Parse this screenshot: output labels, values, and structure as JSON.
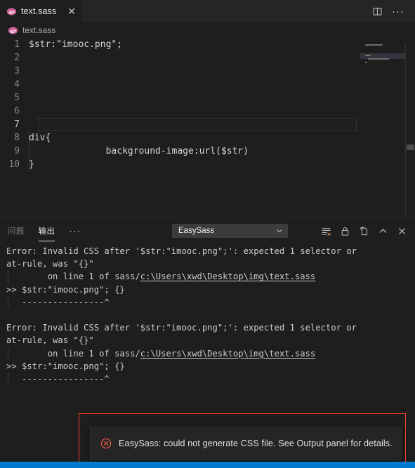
{
  "window": {
    "background": "#1e1e1e",
    "accent": "#007acc",
    "annotation_color": "#ef3b2d"
  },
  "tabbar": {
    "tabs": [
      {
        "label": "text.sass",
        "icon": "sass-icon",
        "close_label": "✕",
        "active": true
      }
    ],
    "actions": [
      {
        "name": "split-editor-icon",
        "label": ""
      },
      {
        "name": "more-actions-icon",
        "label": "···"
      }
    ]
  },
  "breadcrumb": {
    "icon": "sass-icon",
    "label": "text.sass"
  },
  "editor": {
    "language": "sass",
    "current_line": 7,
    "lines": [
      {
        "num": "1",
        "text": "$str:\"imooc.png\";"
      },
      {
        "num": "2",
        "text": ""
      },
      {
        "num": "3",
        "text": ""
      },
      {
        "num": "4",
        "text": ""
      },
      {
        "num": "5",
        "text": ""
      },
      {
        "num": "6",
        "text": ""
      },
      {
        "num": "7",
        "text": ""
      },
      {
        "num": "8",
        "text": "div{"
      },
      {
        "num": "9",
        "text": "    background-image:url($str)"
      },
      {
        "num": "10",
        "text": "}"
      }
    ]
  },
  "panel": {
    "tabs": [
      {
        "label": "问题",
        "active": false
      },
      {
        "label": "输出",
        "active": true
      }
    ],
    "more_label": "···",
    "channel": {
      "selected": "EasySass",
      "options": [
        "EasySass"
      ]
    },
    "actions": [
      {
        "name": "clear-output-icon"
      },
      {
        "name": "lock-scroll-icon"
      },
      {
        "name": "open-in-editor-icon"
      },
      {
        "name": "maximize-panel-icon"
      },
      {
        "name": "close-panel-icon"
      }
    ],
    "output": [
      {
        "kind": "text",
        "text": "Error: Invalid CSS after '$str:\"imooc.png\";': expected 1 selector or"
      },
      {
        "kind": "text",
        "text": "at-rule, was \"{}\""
      },
      {
        "kind": "link",
        "prefix": "        on line 1 of sass/",
        "link": "c:\\Users\\xwd\\Desktop\\img\\text.sass",
        "indented": true
      },
      {
        "kind": "text",
        "text": ">> $str:\"imooc.png\"; {}"
      },
      {
        "kind": "text",
        "text": "   ----------------^",
        "indented": true
      },
      {
        "kind": "blank",
        "text": ""
      },
      {
        "kind": "text",
        "text": "Error: Invalid CSS after '$str:\"imooc.png\";': expected 1 selector or"
      },
      {
        "kind": "text",
        "text": "at-rule, was \"{}\""
      },
      {
        "kind": "link",
        "prefix": "        on line 1 of sass/",
        "link": "c:\\Users\\xwd\\Desktop\\img\\text.sass",
        "indented": true
      },
      {
        "kind": "text",
        "text": ">> $str:\"imooc.png\"; {}"
      },
      {
        "kind": "text",
        "text": "   ----------------^",
        "indented": true
      }
    ]
  },
  "notification": {
    "icon": "error-circle-x-icon",
    "message": "EasySass: could not generate CSS file. See Output panel for details."
  }
}
